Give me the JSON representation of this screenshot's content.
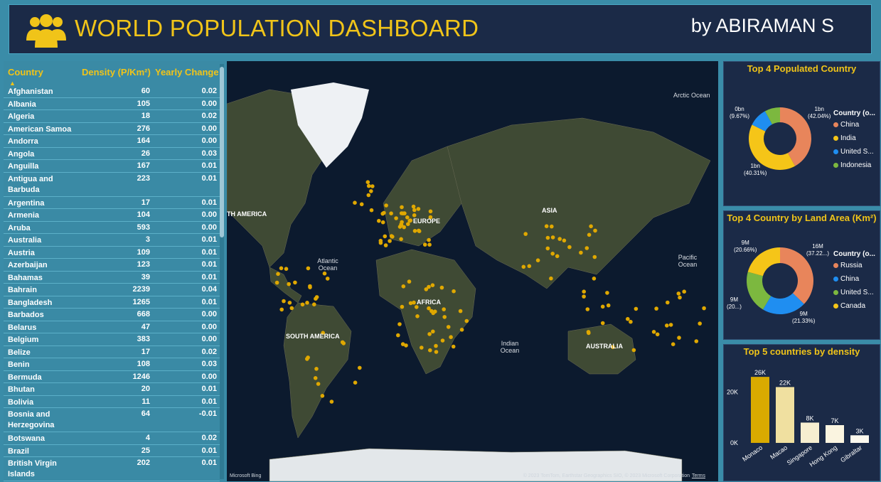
{
  "header": {
    "title": "WORLD POPULATION DASHBOARD",
    "byline": "by ABIRAMAN S",
    "logo_icon": "people-group-icon",
    "accent": "#f0c419"
  },
  "table": {
    "columns": [
      "Country",
      "Density (P/Km²)",
      "Yearly Change"
    ],
    "sort_icon": "sort-up-icon",
    "rows": [
      {
        "country": "Afghanistan",
        "density": "60",
        "change": "0.02"
      },
      {
        "country": "Albania",
        "density": "105",
        "change": "0.00"
      },
      {
        "country": "Algeria",
        "density": "18",
        "change": "0.02"
      },
      {
        "country": "American Samoa",
        "density": "276",
        "change": "0.00"
      },
      {
        "country": "Andorra",
        "density": "164",
        "change": "0.00"
      },
      {
        "country": "Angola",
        "density": "26",
        "change": "0.03"
      },
      {
        "country": "Anguilla",
        "density": "167",
        "change": "0.01"
      },
      {
        "country": "Antigua and Barbuda",
        "density": "223",
        "change": "0.01"
      },
      {
        "country": "Argentina",
        "density": "17",
        "change": "0.01"
      },
      {
        "country": "Armenia",
        "density": "104",
        "change": "0.00"
      },
      {
        "country": "Aruba",
        "density": "593",
        "change": "0.00"
      },
      {
        "country": "Australia",
        "density": "3",
        "change": "0.01"
      },
      {
        "country": "Austria",
        "density": "109",
        "change": "0.01"
      },
      {
        "country": "Azerbaijan",
        "density": "123",
        "change": "0.01"
      },
      {
        "country": "Bahamas",
        "density": "39",
        "change": "0.01"
      },
      {
        "country": "Bahrain",
        "density": "2239",
        "change": "0.04"
      },
      {
        "country": "Bangladesh",
        "density": "1265",
        "change": "0.01"
      },
      {
        "country": "Barbados",
        "density": "668",
        "change": "0.00"
      },
      {
        "country": "Belarus",
        "density": "47",
        "change": "0.00"
      },
      {
        "country": "Belgium",
        "density": "383",
        "change": "0.00"
      },
      {
        "country": "Belize",
        "density": "17",
        "change": "0.02"
      },
      {
        "country": "Benin",
        "density": "108",
        "change": "0.03"
      },
      {
        "country": "Bermuda",
        "density": "1246",
        "change": "0.00"
      },
      {
        "country": "Bhutan",
        "density": "20",
        "change": "0.01"
      },
      {
        "country": "Bolivia",
        "density": "11",
        "change": "0.01"
      },
      {
        "country": "Bosnia and Herzegovina",
        "density": "64",
        "change": "-0.01"
      },
      {
        "country": "Botswana",
        "density": "4",
        "change": "0.02"
      },
      {
        "country": "Brazil",
        "density": "25",
        "change": "0.01"
      },
      {
        "country": "British Virgin Islands",
        "density": "202",
        "change": "0.01"
      }
    ]
  },
  "map": {
    "labels": {
      "arctic": "Arctic Ocean",
      "north_america": "TH AMERICA",
      "europe": "EUROPE",
      "asia": "ASIA",
      "atlantic": "Atlantic Ocean",
      "pacific": "Pacific Ocean",
      "africa": "AFRICA",
      "south_america": "SOUTH AMERICA",
      "indian": "Indian Ocean",
      "australia": "AUSTRALIA"
    },
    "bing": "Microsoft Bing",
    "copyright": "© 2023 TomTom, Earthstar Geographics SIO, © 2023 Microsoft Corporation",
    "terms": "Terms",
    "ocean_color": "#0c1a2e",
    "point_color": "#e0a800"
  },
  "chart_data": [
    {
      "type": "pie",
      "title": "Top 4 Populated Country",
      "legend_title": "Country (o...",
      "legend_position": "right",
      "categories": [
        "China",
        "India",
        "United S...",
        "Indonesia"
      ],
      "values_pct": [
        42.04,
        40.31,
        9.67,
        7.98
      ],
      "colors": [
        "#e8855b",
        "#f5c518",
        "#1f8ef1",
        "#7cb83f"
      ],
      "labels": [
        {
          "value": "1bn",
          "pct": "(42.04%)"
        },
        {
          "value": "1bn",
          "pct": "(40.31%)"
        },
        {
          "value": "0bn",
          "pct": "(9.67%)"
        }
      ]
    },
    {
      "type": "pie",
      "title": "Top 4 Country by Land Area (Km²)",
      "legend_title": "Country (o...",
      "legend_position": "right",
      "categories": [
        "Russia",
        "China",
        "United S...",
        "Canada"
      ],
      "values_pct": [
        37.22,
        21.33,
        20.79,
        20.66
      ],
      "colors": [
        "#e8855b",
        "#1f8ef1",
        "#7cb83f",
        "#f5c518"
      ],
      "labels": [
        {
          "value": "16M",
          "pct": "(37.22...)"
        },
        {
          "value": "9M",
          "pct": "(21.33%)"
        },
        {
          "value": "9M",
          "pct": "(20...)"
        },
        {
          "value": "9M",
          "pct": "(20.66%)"
        }
      ]
    },
    {
      "type": "bar",
      "title": "Top 5 countries by density",
      "categories": [
        "Monaco",
        "Macao",
        "Singapore",
        "Hong Kong",
        "Gibraltar"
      ],
      "values": [
        26000,
        22000,
        8000,
        7000,
        3000
      ],
      "value_labels": [
        "26K",
        "22K",
        "8K",
        "7K",
        "3K"
      ],
      "yticks": [
        "0K",
        "20K"
      ],
      "ylim": [
        0,
        28000
      ],
      "colors": [
        "#d9aa00",
        "#f0e0a0",
        "#f6eed0",
        "#faf4e0",
        "#fdf9ee"
      ],
      "grid": false
    }
  ]
}
